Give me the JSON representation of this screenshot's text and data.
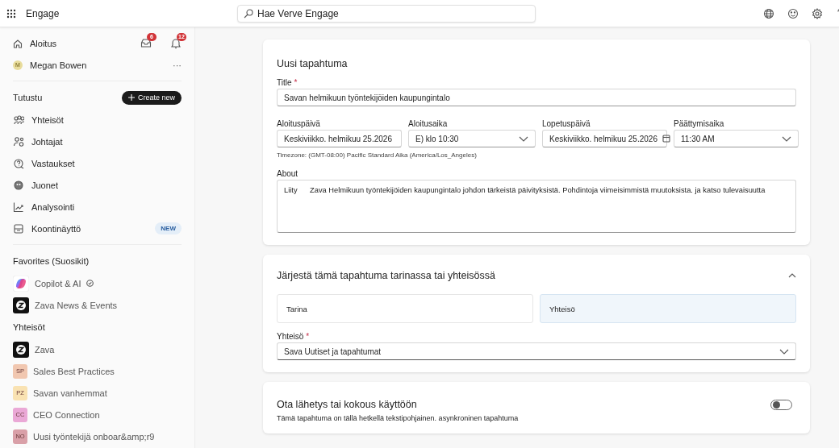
{
  "topbar": {
    "app_name": "Engage",
    "search": {
      "placeholder": "Hae Verve Engage"
    }
  },
  "sidebar": {
    "home": {
      "label": "Aloitus",
      "inbox_badge": "6",
      "notifications_badge": "12"
    },
    "user": {
      "initial": "M",
      "name": "Megan Bowen",
      "more": "···"
    },
    "explore": {
      "heading": "Tutustu",
      "create_button": "Create new",
      "items": [
        {
          "label": "Yhteisöt",
          "kind": "people"
        },
        {
          "label": "Johtajat",
          "kind": "leaders"
        },
        {
          "label": "Vastaukset",
          "kind": "answers"
        },
        {
          "label": "Juonet",
          "kind": "storylines"
        },
        {
          "label": "Analysointi",
          "kind": "chart"
        },
        {
          "label": "Koontinäyttö",
          "kind": "dashboard",
          "badge": "NEW"
        }
      ]
    },
    "favorites": {
      "heading": "Favorites (Suosikit)",
      "items": [
        {
          "kind": "copilot",
          "label": "Copilot & AI",
          "verified": true
        },
        {
          "kind": "zava",
          "label": "Zava News & Events",
          "verified": false
        }
      ]
    },
    "communities": {
      "heading": "Yhteisöt",
      "items": [
        {
          "kind": "zava",
          "label": "Zava"
        },
        {
          "kind": "initials",
          "initials": "SP",
          "label": "Sales Best Practices",
          "color": "#f1c7b0"
        },
        {
          "kind": "initials",
          "initials": "PZ",
          "label": "Savan vanhemmat",
          "color": "#f9e2b2"
        },
        {
          "kind": "initials",
          "initials": "CC",
          "label": "CEO Connection",
          "color": "#eaa8d6"
        },
        {
          "kind": "initials",
          "initials": "NO",
          "label": "Uusi työntekijä onboar&amp;r9",
          "color": "#d9a0a8"
        }
      ]
    }
  },
  "event_card": {
    "title": "Uusi tapahtuma",
    "title_field": {
      "label": "Title",
      "required_mark": "*",
      "value": "Savan helmikuun työntekijöiden kaupungintalo"
    },
    "start_date": {
      "label": "Aloituspäivä",
      "value": "Keskiviikko. helmikuu 25.2026"
    },
    "start_time": {
      "label": "Aloitusaika",
      "value": "E) klo 10:30"
    },
    "end_date": {
      "label": "Lopetuspäivä",
      "value": "Keskiviikko. helmikuu 25.2026"
    },
    "end_time": {
      "label": "Päättymisaika",
      "value": "11:30 AM"
    },
    "timezone": "Timezone: (GMT-08:00) Pacific Standard Aika  (America/Los_Angeles)",
    "about": {
      "label": "About",
      "value": "Liity      Zava Helmikuun työntekijöiden kaupungintalo johdon tärkeistä päivityksistä. Pohdintoja viimeisimmistä muutoksista. ja katso tulevaisuutta"
    }
  },
  "organize_card": {
    "title": "Järjestä tämä tapahtuma tarinassa tai yhteisössä",
    "expanded": true,
    "options": [
      {
        "label": "Tarina",
        "selected": false
      },
      {
        "label": "Yhteisö",
        "selected": true
      }
    ],
    "community_field": {
      "label": "Yhteisö",
      "required_mark": "*",
      "value": "Sava Uutiset ja tapahtumat"
    }
  },
  "broadcast_card": {
    "title": "Ota lähetys tai kokous käyttöön",
    "on": false,
    "description": "Tämä tapahtuma on tällä hetkellä tekstipohjainen. asynkroninen tapahtuma"
  }
}
